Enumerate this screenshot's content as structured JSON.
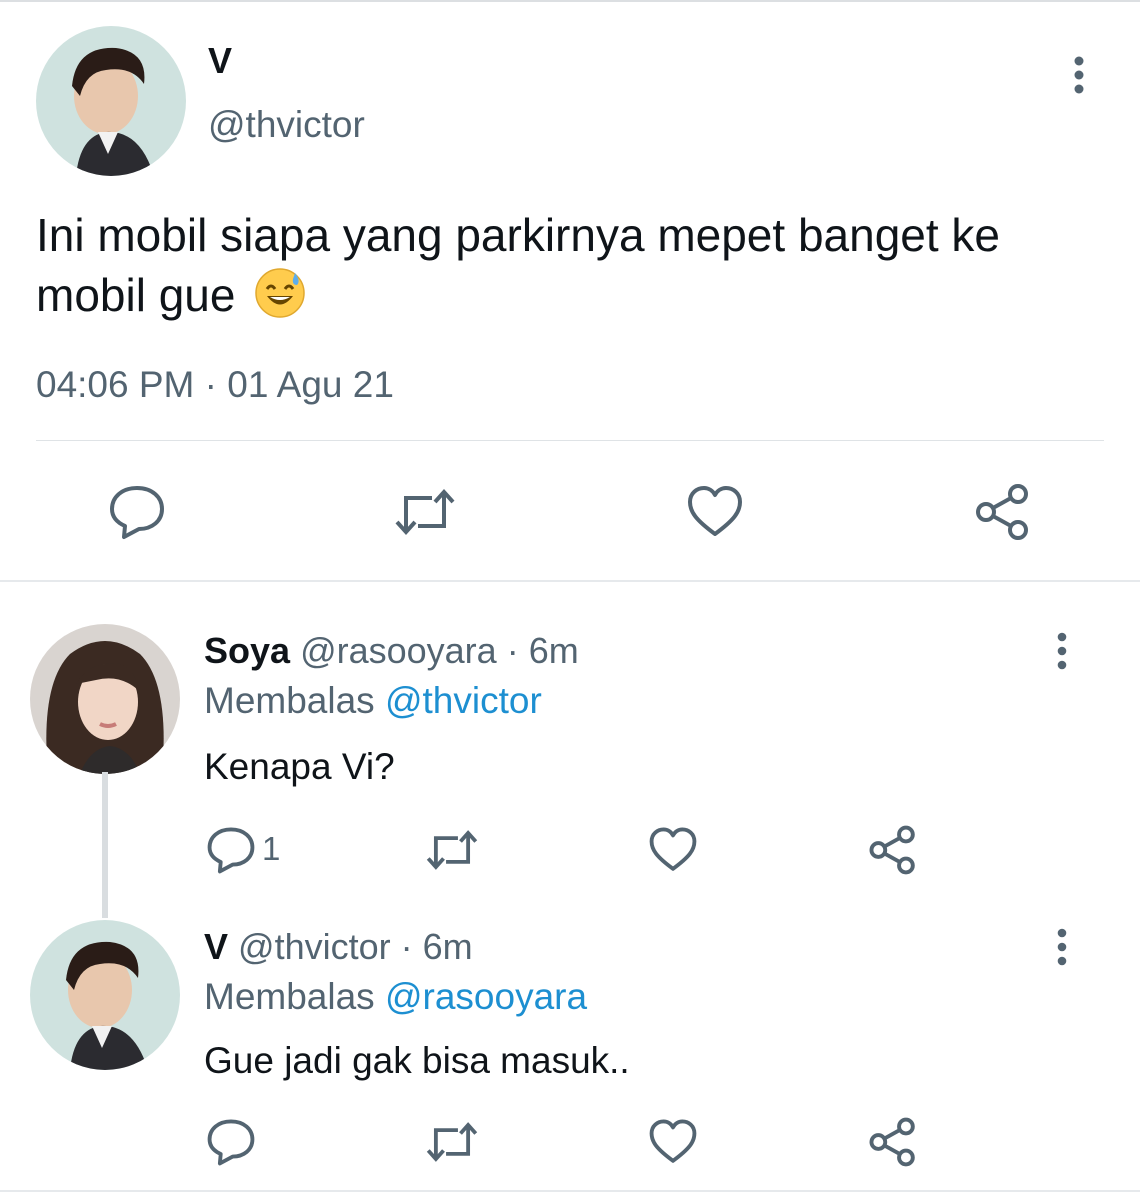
{
  "main_tweet": {
    "name": "V",
    "handle": "@thvictor",
    "text": "Ini mobil siapa yang parkirnya mepet banget ke mobil gue",
    "emoji": "😅",
    "timestamp": "04:06 PM · 01 Agu 21"
  },
  "replies": [
    {
      "name": "Soya",
      "handle": "@rasooyara",
      "time": "· 6m",
      "replying_label": "Membalas",
      "replying_to": "@thvictor",
      "text": "Kenapa Vi?",
      "reply_count": "1"
    },
    {
      "name": "V",
      "handle": "@thvictor",
      "time": "· 6m",
      "replying_label": "Membalas",
      "replying_to": "@rasooyara",
      "text": "Gue jadi gak bisa masuk.."
    }
  ],
  "icons": [
    "more-icon",
    "reply-icon",
    "retweet-icon",
    "like-icon",
    "share-icon"
  ],
  "colors": {
    "text": "#0f1419",
    "muted": "#536471",
    "mention": "#1d8fd1",
    "divider": "#dfe3e6"
  }
}
